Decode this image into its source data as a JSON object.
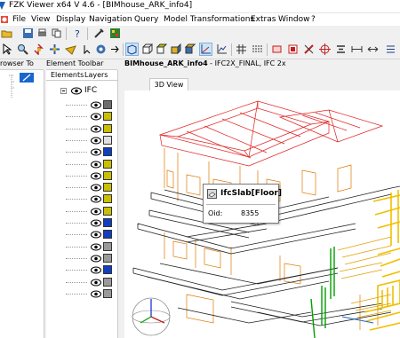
{
  "window": {
    "title": "FZK Viewer x64 V 4.6 - [BIMhouse_ARK_info4]"
  },
  "menu": [
    {
      "label": "File"
    },
    {
      "label": "View"
    },
    {
      "label": "Display"
    },
    {
      "label": "Navigation"
    },
    {
      "label": "Query"
    },
    {
      "label": "Model Transformations"
    },
    {
      "label": "Extras"
    },
    {
      "label": "Window"
    },
    {
      "label": "?"
    }
  ],
  "panels": {
    "browser_header": "rowser To",
    "element_toolbar_header": "Element Toolbar",
    "tabs": [
      {
        "label": "Elements"
      },
      {
        "label": "Layers"
      }
    ],
    "root_label": "IFC"
  },
  "element_icons": [
    {
      "icon": "ifc-root-icon",
      "color": "#6d6d6d"
    },
    {
      "icon": "building-icon",
      "color": "#c8c000"
    },
    {
      "icon": "beam-icon",
      "color": "#c8c000"
    },
    {
      "icon": "space-icon",
      "color": "#e0e0e0"
    },
    {
      "icon": "column-icon",
      "color": "#1040c0"
    },
    {
      "icon": "door-icon",
      "color": "#c8c000"
    },
    {
      "icon": "window-icon",
      "color": "#c8c000"
    },
    {
      "icon": "furnishing-icon",
      "color": "#c8c000"
    },
    {
      "icon": "railing-icon",
      "color": "#c8c000"
    },
    {
      "icon": "wall-icon",
      "color": "#c8c000"
    },
    {
      "icon": "covering-icon",
      "color": "#1040c0"
    },
    {
      "icon": "slab-icon",
      "color": "#1040c0"
    },
    {
      "icon": "roof-icon",
      "color": "#9a9a9a"
    },
    {
      "icon": "stair-icon",
      "color": "#9a9a9a"
    },
    {
      "icon": "proxy-icon",
      "color": "#1040c0"
    },
    {
      "icon": "opening-icon",
      "color": "#9a9a9a"
    },
    {
      "icon": "plate-icon",
      "color": "#9a9a9a"
    }
  ],
  "view": {
    "doc_name": "BIMhouse_ARK_info4",
    "doc_suffix": " - IFC2X_FINAL, IFC 2x",
    "tab": "3D View"
  },
  "tooltip": {
    "name": "IfcSlab[Floor]",
    "key": "Oid:",
    "value": "8355"
  },
  "colors": {
    "roof": "#e02020",
    "walls": "#e07800",
    "floors": "#202020",
    "structure_green": "#00a000",
    "stair_yellow": "#f0c000"
  }
}
